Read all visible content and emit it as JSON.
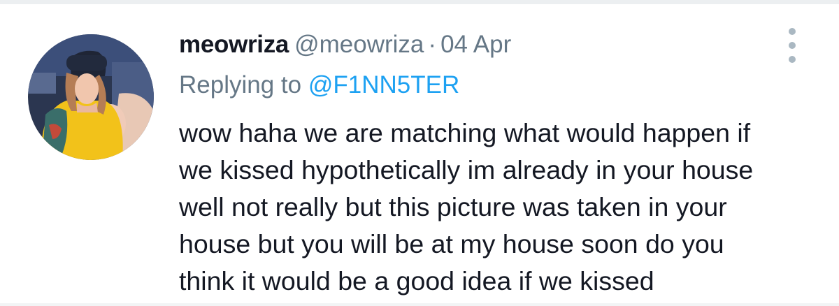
{
  "tweet": {
    "display_name": "meowriza",
    "handle": "@meowriza",
    "separator": "·",
    "date": "04 Apr",
    "replying_prefix": "Replying to",
    "replying_mention": "@F1NN5TER",
    "text_lines": [
      "wow haha we are matching what would happen if",
      "we kissed hypothetically im already in your house",
      "well not really but this picture was taken in your",
      "house but you will be at my house soon do you",
      "think it would be a good idea if we kissed"
    ],
    "more_icon": "more-vertical-icon",
    "avatar_icon": "profile-avatar"
  },
  "colors": {
    "name": "#141823",
    "meta": "#657786",
    "mention": "#1da1f2",
    "divider": "#eceff1"
  }
}
